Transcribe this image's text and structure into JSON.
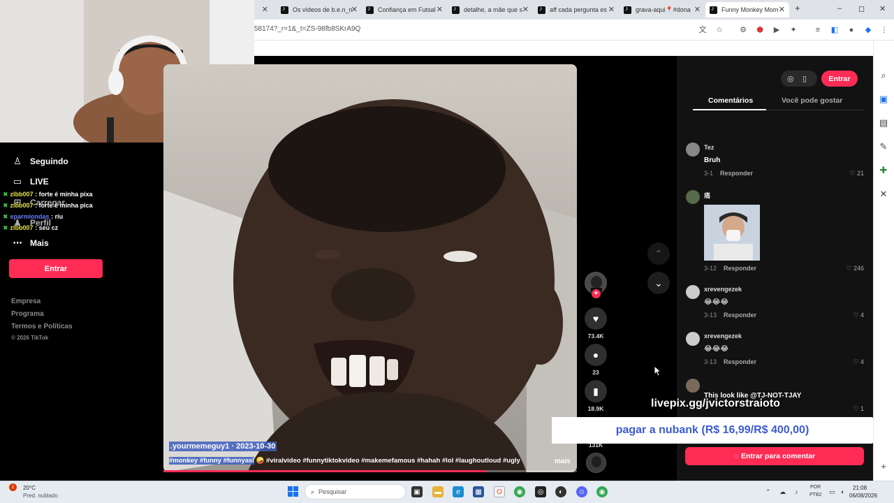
{
  "browser": {
    "tabs": [
      {
        "label": "Os vídeos de b.e.n_n"
      },
      {
        "label": "Confiança em Futsal"
      },
      {
        "label": "detalhe, a mãe que s"
      },
      {
        "label": "aff cada pergunta es"
      },
      {
        "label": "grava-aqui📍#dona"
      },
      {
        "label": "Funny Monkey Mom"
      }
    ],
    "new_tab": "+",
    "url": "58174?_r=1&_t=ZS-98fb8SKrA9Q",
    "window_controls": [
      "–",
      "◻",
      "✕"
    ]
  },
  "sidebar": {
    "items": [
      {
        "label": "Seguindo",
        "icon": "person-follow-icon"
      },
      {
        "label": "LIVE",
        "icon": "live-icon"
      },
      {
        "label": "Carregar",
        "icon": "upload-icon"
      },
      {
        "label": "Perfil",
        "icon": "profile-icon"
      },
      {
        "label": "Mais",
        "icon": "more-icon"
      }
    ],
    "login_button": "Entrar",
    "footer_links": [
      "Empresa",
      "Programa",
      "Termos e Políticas"
    ],
    "copyright": "© 2026 TikTok"
  },
  "chat": [
    {
      "user": "zlbb007",
      "message": ": forte é minha pixa"
    },
    {
      "user": "zlbb007",
      "message": ": forte é minha pica"
    },
    {
      "user": "eparmiondas",
      "message": ": riu"
    },
    {
      "user": "zlbb007",
      "message": ": seu cz"
    }
  ],
  "video": {
    "author_date": ".yourmemeguy1 · 2023-10-30",
    "tags_highlighted": "#monkey #funny #funnyasl",
    "tags_rest": "🤪 #viralvideo #funnytiktokvideo #makemefamous #hahah #lol #laughoutloud #ugly",
    "more": "mais",
    "progress": 0.78
  },
  "actions": {
    "likes": "73.4K",
    "comments": "23",
    "saves": "18.9K",
    "shares": "131K"
  },
  "comments_panel": {
    "login_button": "Entrar",
    "tabs": [
      "Comentários",
      "Você pode gostar"
    ],
    "comments": [
      {
        "user": "Tez",
        "text": "Bruh",
        "date": "3-1",
        "reply": "Responder",
        "likes": "21"
      },
      {
        "user": "痛",
        "text": "",
        "date": "3-12",
        "reply": "Responder",
        "likes": "246"
      },
      {
        "user": "xrevengezek",
        "text": "😂😂😂",
        "date": "3-13",
        "reply": "Responder",
        "likes": "4"
      },
      {
        "user": "xrevengezek",
        "text": "😂😂😂",
        "date": "3-13",
        "reply": "Responder",
        "likes": "4"
      },
      {
        "user": "",
        "text": "This look like @TJ-NOT-TJAY",
        "date": "",
        "reply": "",
        "likes": "1"
      }
    ],
    "comment_login": "Entrar para comentar"
  },
  "overlays": {
    "livepix": "livepix.gg/jvictorstraioto",
    "nubank": "pagar a nubank (R$ 16,99/R$ 400,00)"
  },
  "taskbar": {
    "weather_temp": "20°C",
    "weather_desc": "Pred. nublado",
    "weather_badge": "1",
    "search_placeholder": "Pesquisar",
    "lang_top": "POR",
    "lang_bottom": "PTB2",
    "time": "21:08",
    "date": "06/08/2026"
  },
  "colors": {
    "accent": "#fe2c55",
    "highlight": "#3e5ebd"
  }
}
